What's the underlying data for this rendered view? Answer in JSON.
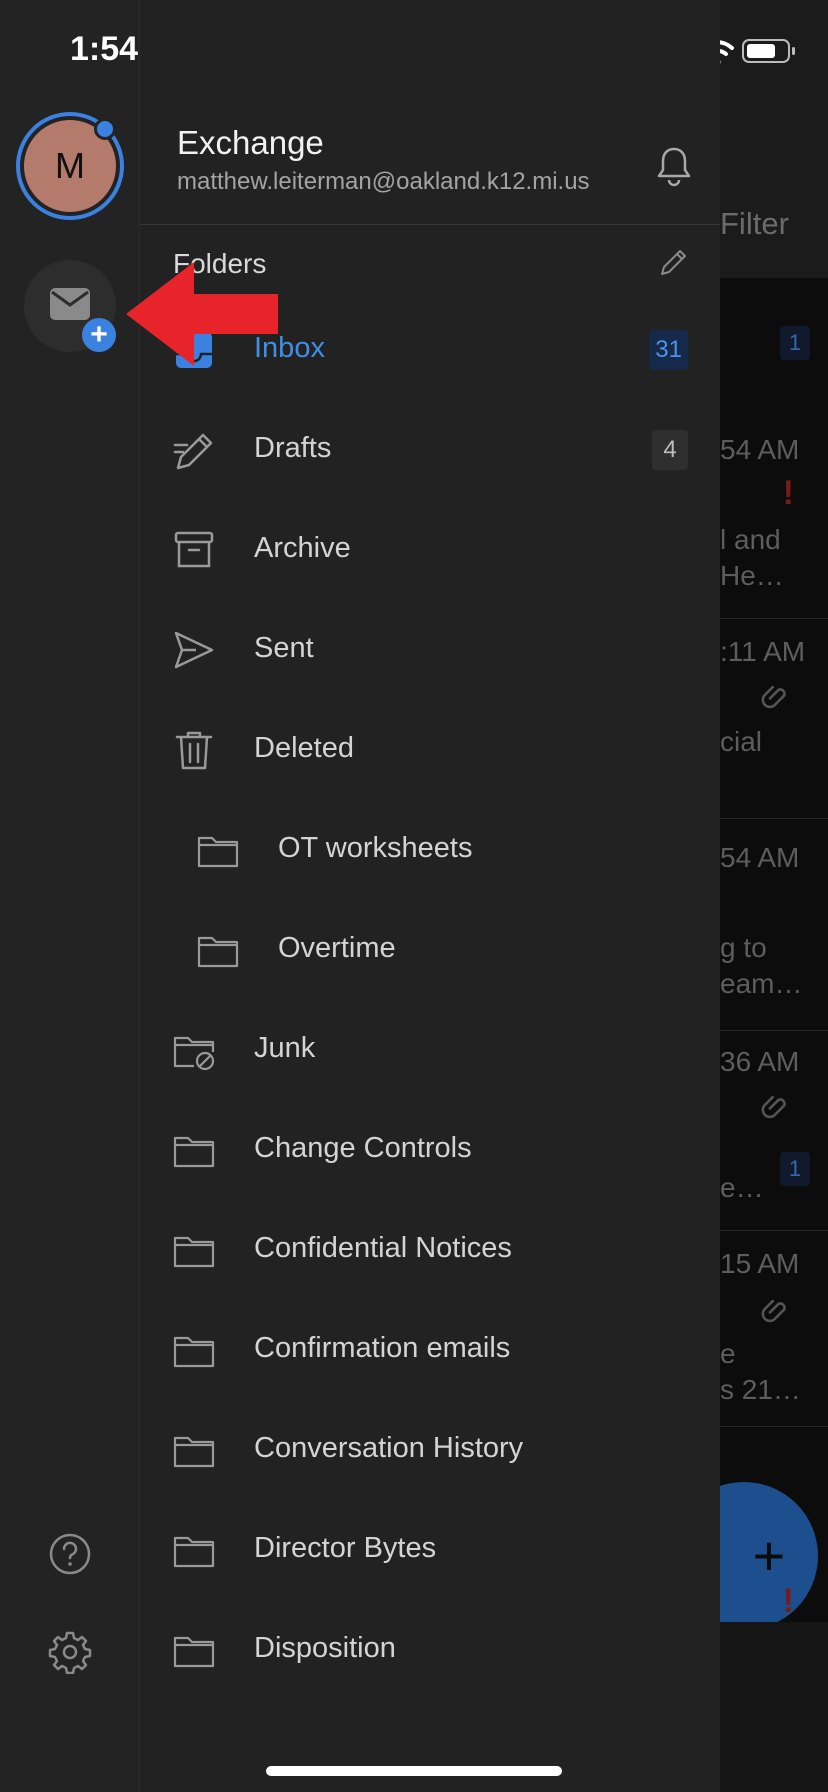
{
  "status_bar": {
    "time": "1:54"
  },
  "background_list": {
    "filter_label": "Filter",
    "badges": [
      "1",
      "1"
    ],
    "times": [
      "54 AM",
      ":11 AM",
      "54 AM",
      "36 AM",
      "15 AM"
    ],
    "snippets": [
      "l and",
      " He…",
      "cial",
      "g to",
      "eam…",
      "e…",
      "e",
      "s 21…"
    ]
  },
  "rail": {
    "avatar_initial": "M",
    "icons": [
      "mail-icon",
      "help-icon",
      "settings-icon"
    ]
  },
  "account": {
    "name": "Exchange",
    "email": "matthew.leiterman@oakland.k12.mi.us"
  },
  "folders_header": {
    "title": "Folders"
  },
  "folders": [
    {
      "label": "Inbox",
      "count": "31",
      "icon": "inbox-icon",
      "active": true
    },
    {
      "label": "Drafts",
      "count": "4",
      "icon": "drafts-icon"
    },
    {
      "label": "Archive",
      "icon": "archive-icon"
    },
    {
      "label": "Sent",
      "icon": "sent-icon"
    },
    {
      "label": "Deleted",
      "icon": "trash-icon"
    },
    {
      "label": "OT worksheets",
      "icon": "folder-icon",
      "sub": true
    },
    {
      "label": "Overtime",
      "icon": "folder-icon",
      "sub": true
    },
    {
      "label": "Junk",
      "icon": "junk-icon"
    },
    {
      "label": "Change Controls",
      "icon": "folder-icon"
    },
    {
      "label": "Confidential Notices",
      "icon": "folder-icon"
    },
    {
      "label": "Confirmation emails",
      "icon": "folder-icon"
    },
    {
      "label": "Conversation History",
      "icon": "folder-icon"
    },
    {
      "label": "Director Bytes",
      "icon": "folder-icon"
    },
    {
      "label": "Disposition",
      "icon": "folder-icon"
    }
  ],
  "colors": {
    "accent": "#3B82E0",
    "drawer_bg": "#222222",
    "rail_bg": "#232323",
    "annotation_arrow": "#E8242B"
  }
}
